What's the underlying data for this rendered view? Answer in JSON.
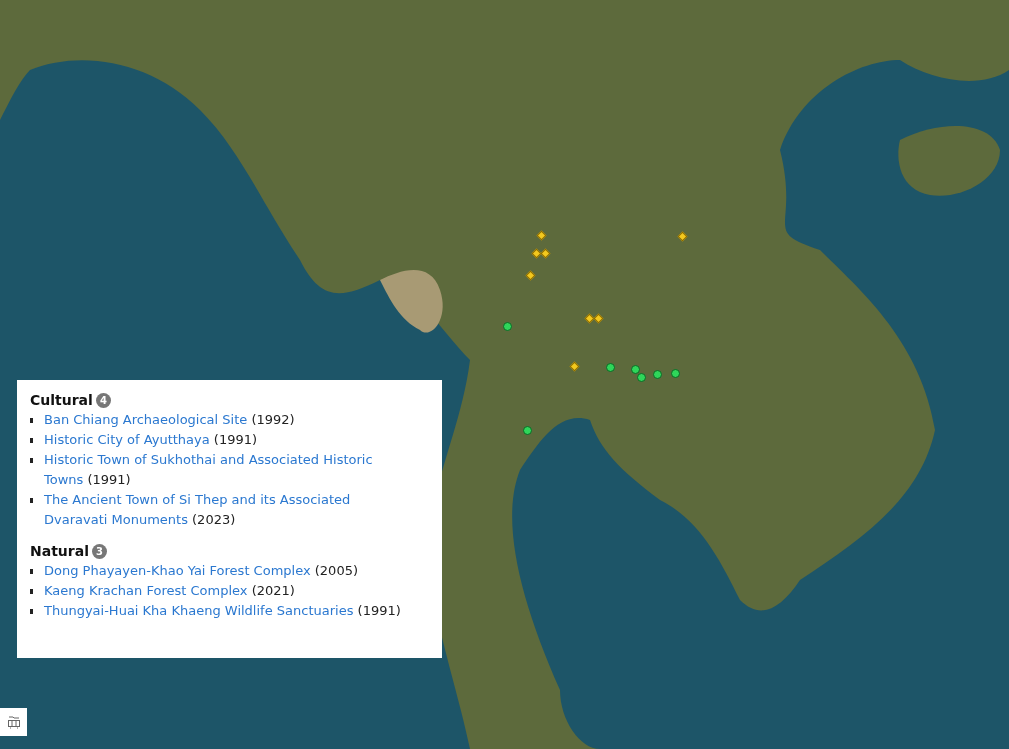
{
  "map": {
    "markers": [
      {
        "kind": "cultural"
      },
      {
        "kind": "cultural"
      },
      {
        "kind": "cultural"
      },
      {
        "kind": "cultural"
      },
      {
        "kind": "cultural"
      },
      {
        "kind": "cultural"
      },
      {
        "kind": "cultural"
      },
      {
        "kind": "cultural"
      },
      {
        "kind": "natural"
      },
      {
        "kind": "natural"
      },
      {
        "kind": "natural"
      },
      {
        "kind": "natural"
      },
      {
        "kind": "natural"
      },
      {
        "kind": "natural"
      },
      {
        "kind": "natural"
      }
    ]
  },
  "legend": {
    "groups": [
      {
        "title": "Cultural",
        "count": "4",
        "sites": [
          {
            "name": "Ban Chiang Archaeological Site",
            "year": "(1992)"
          },
          {
            "name": "Historic City of Ayutthaya",
            "year": "(1991)"
          },
          {
            "name": "Historic Town of Sukhothai and Associated Historic Towns",
            "year": "(1991)"
          },
          {
            "name": "The Ancient Town of Si Thep and its Associated Dvaravati Monuments",
            "year": "(2023)"
          }
        ]
      },
      {
        "title": "Natural",
        "count": "3",
        "sites": [
          {
            "name": "Dong Phayayen-Khao Yai Forest Complex",
            "year": "(2005)"
          },
          {
            "name": "Kaeng Krachan Forest Complex",
            "year": "(2021)"
          },
          {
            "name": "Thungyai-Huai Kha Khaeng Wildlife Sanctuaries",
            "year": "(1991)"
          }
        ]
      }
    ]
  }
}
